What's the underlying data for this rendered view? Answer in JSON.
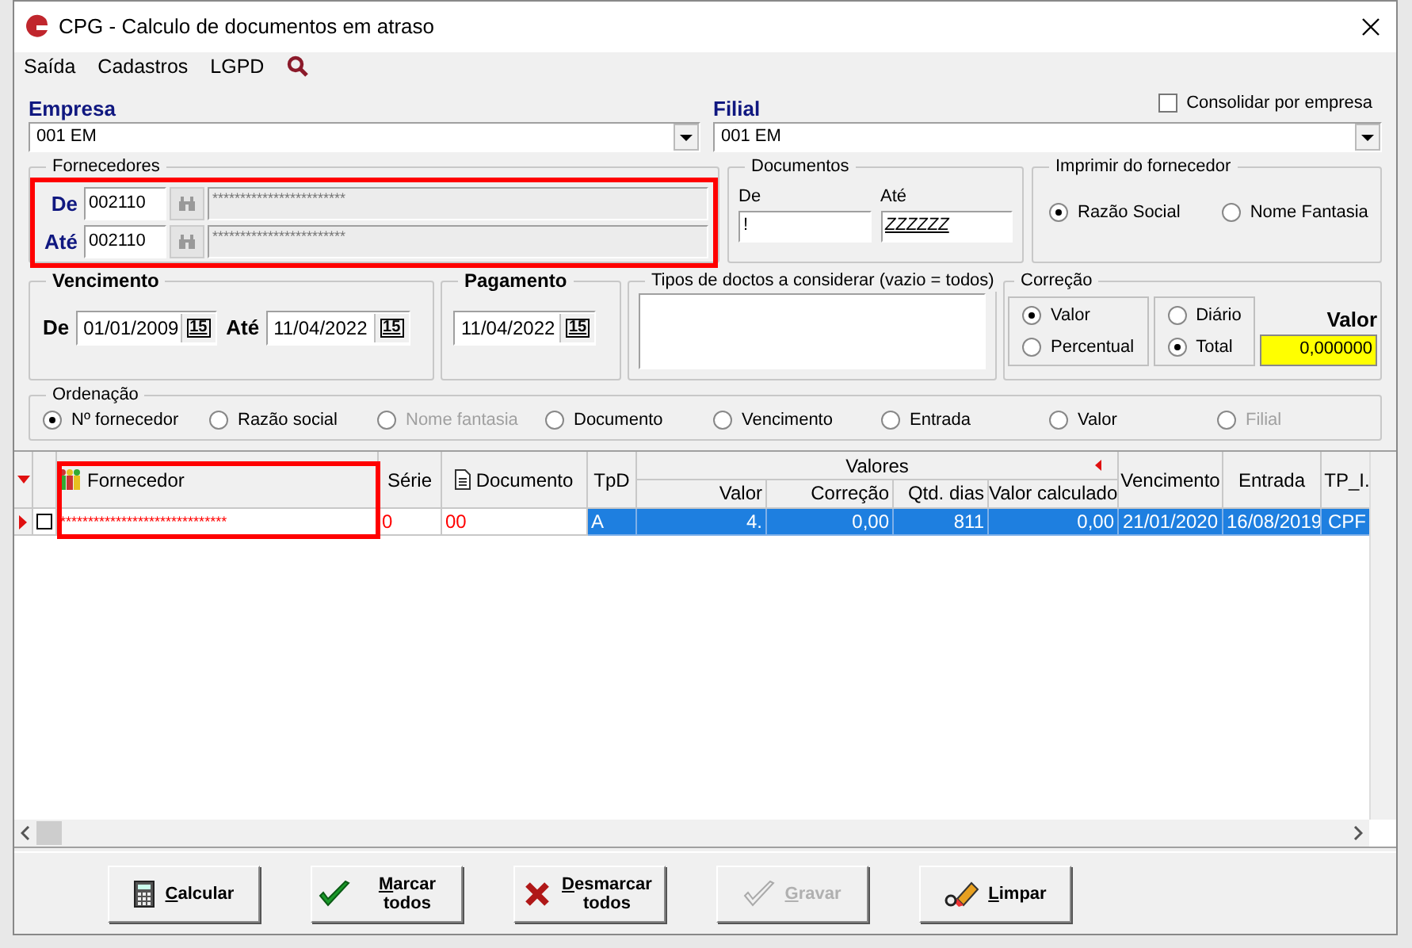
{
  "window": {
    "title": "CPG - Calculo de documentos em atraso"
  },
  "menu": [
    "Saída",
    "Cadastros",
    "LGPD"
  ],
  "empresa": {
    "label": "Empresa",
    "value": "001 EM"
  },
  "filial": {
    "label": "Filial",
    "value": "001 EM"
  },
  "consolidar": {
    "label": "Consolidar por empresa",
    "checked": false
  },
  "fornecedores": {
    "title": "Fornecedores",
    "rows": [
      {
        "label": "De",
        "code": "002110",
        "name": "************************"
      },
      {
        "label": "Até",
        "code": "002110",
        "name": "************************"
      }
    ]
  },
  "documentos": {
    "title": "Documentos",
    "from": {
      "label": "De",
      "value": "!"
    },
    "to": {
      "label": "Até",
      "value": "ZZZZZZ"
    }
  },
  "imprimir": {
    "title": "Imprimir do fornecedor",
    "options": [
      {
        "label": "Razão Social",
        "selected": true
      },
      {
        "label": "Nome Fantasia",
        "selected": false
      }
    ]
  },
  "vencimento": {
    "title": "Vencimento",
    "from": {
      "label": "De",
      "value": "01/01/2009",
      "calendar": "15"
    },
    "to": {
      "label": "Até",
      "value": "11/04/2022",
      "calendar": "15"
    }
  },
  "pagamento": {
    "title": "Pagamento",
    "value": "11/04/2022",
    "calendar": "15"
  },
  "tipos": {
    "title": "Tipos de doctos a considerar (vazio = todos)"
  },
  "correcao": {
    "title": "Correção",
    "modo": [
      {
        "label": "Valor",
        "selected": true
      },
      {
        "label": "Percentual",
        "selected": false
      }
    ],
    "periodo": [
      {
        "label": "Diário",
        "selected": false
      },
      {
        "label": "Total",
        "selected": true
      }
    ],
    "valor": {
      "label": "Valor",
      "value": "0,000000"
    }
  },
  "ordenacao": {
    "title": "Ordenação",
    "options": [
      {
        "label": "Nº fornecedor",
        "selected": true,
        "disabled": false
      },
      {
        "label": "Razão social",
        "selected": false,
        "disabled": false
      },
      {
        "label": "Nome fantasia",
        "selected": false,
        "disabled": true
      },
      {
        "label": "Documento",
        "selected": false,
        "disabled": false
      },
      {
        "label": "Vencimento",
        "selected": false,
        "disabled": false
      },
      {
        "label": "Entrada",
        "selected": false,
        "disabled": false
      },
      {
        "label": "Valor",
        "selected": false,
        "disabled": false
      },
      {
        "label": "Filial",
        "selected": false,
        "disabled": true
      }
    ]
  },
  "grid": {
    "group_header": "Valores",
    "columns": [
      {
        "label": "Fornecedor",
        "kind": "people"
      },
      {
        "label": "Série",
        "kind": "plain"
      },
      {
        "label": "Documento",
        "kind": "document"
      },
      {
        "label": "TpD",
        "kind": "plain"
      },
      {
        "label": "Valor",
        "kind": "grouped"
      },
      {
        "label": "Correção",
        "kind": "grouped"
      },
      {
        "label": "Qtd. dias",
        "kind": "grouped"
      },
      {
        "label": "Valor calculado",
        "kind": "grouped"
      },
      {
        "label": "Vencimento",
        "kind": "plain"
      },
      {
        "label": "Entrada",
        "kind": "plain"
      },
      {
        "label": "TP_I.",
        "kind": "plain"
      }
    ],
    "rows": [
      {
        "checked": false,
        "selected": true,
        "cells": [
          "******************************",
          "0",
          "00",
          "A",
          "4.",
          "0,00",
          "811",
          "0,00",
          "21/01/2020",
          "16/08/2019",
          "CPF"
        ]
      }
    ]
  },
  "buttons": [
    {
      "label": "Calcular",
      "kind": "calculator",
      "disabled": false
    },
    {
      "label": "Marcar todos",
      "kind": "check",
      "disabled": false
    },
    {
      "label": "Desmarcar todos",
      "kind": "cross",
      "disabled": false
    },
    {
      "label": "Gravar",
      "kind": "check",
      "disabled": true
    },
    {
      "label": "Limpar",
      "kind": "eraser",
      "disabled": false
    }
  ]
}
